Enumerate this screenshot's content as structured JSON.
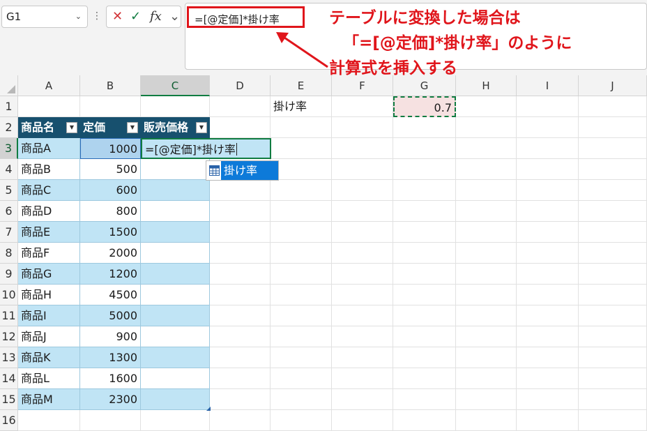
{
  "formula_bar": {
    "name_box": "G1",
    "formula": "=[@定価]*掛け率"
  },
  "annotation": {
    "line1": "テーブルに変換した場合は",
    "line2": "「=[@定価]*掛け率」のように",
    "line3": "計算式を挿入する",
    "color": "#e0151b"
  },
  "columns": [
    "A",
    "B",
    "C",
    "D",
    "E",
    "F",
    "G",
    "H",
    "I",
    "J"
  ],
  "rows": [
    "1",
    "2",
    "3",
    "4",
    "5",
    "6",
    "7",
    "8",
    "9",
    "10",
    "11",
    "12",
    "13",
    "14",
    "15",
    "16"
  ],
  "table": {
    "headers": [
      "商品名",
      "定価",
      "販売価格"
    ],
    "rows": [
      [
        "商品A",
        "1000",
        "=[@定価]*掛け率"
      ],
      [
        "商品B",
        "500",
        ""
      ],
      [
        "商品C",
        "600",
        ""
      ],
      [
        "商品D",
        "800",
        ""
      ],
      [
        "商品E",
        "1500",
        ""
      ],
      [
        "商品F",
        "2000",
        ""
      ],
      [
        "商品G",
        "1200",
        ""
      ],
      [
        "商品H",
        "4500",
        ""
      ],
      [
        "商品I",
        "5000",
        ""
      ],
      [
        "商品J",
        "900",
        ""
      ],
      [
        "商品K",
        "1300",
        ""
      ],
      [
        "商品L",
        "1600",
        ""
      ],
      [
        "商品M",
        "2300",
        ""
      ]
    ],
    "header_color": "#17506e",
    "band_color": "#c0e4f5"
  },
  "cells": {
    "E1": "掛け率",
    "G1": "0.7"
  },
  "autocomplete": {
    "item": "掛け率",
    "icon": "table-icon"
  }
}
